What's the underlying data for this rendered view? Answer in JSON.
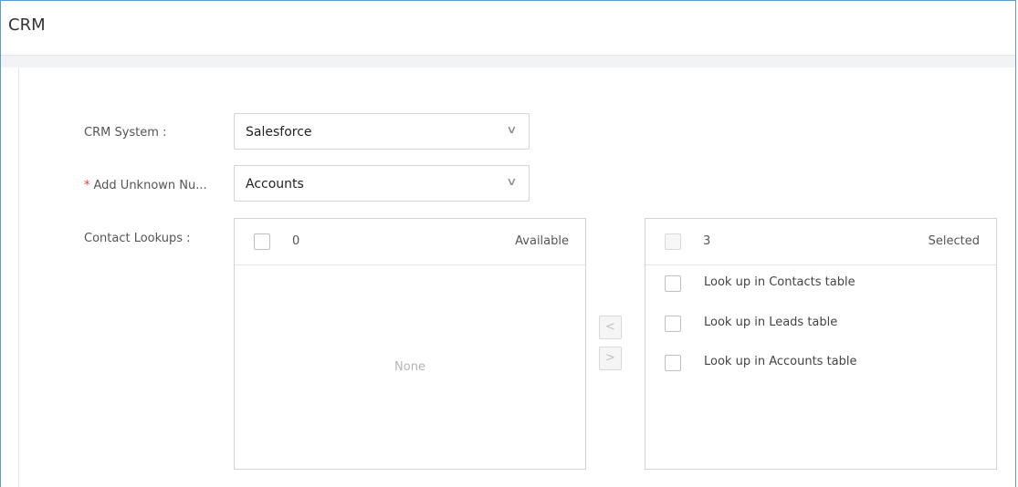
{
  "header": {
    "title": "CRM"
  },
  "form": {
    "crm_system": {
      "label": "CRM System :",
      "value": "Salesforce"
    },
    "add_unknown": {
      "required_mark": "*",
      "label": "Add Unknown Nu...",
      "value": "Accounts"
    },
    "contact_lookups": {
      "label": "Contact Lookups :"
    }
  },
  "transfer": {
    "available": {
      "count": "0",
      "title": "Available",
      "empty_text": "None"
    },
    "selected": {
      "count": "3",
      "title": "Selected",
      "items": [
        {
          "label": "Look up in Contacts table",
          "checked": false
        },
        {
          "label": "Look up in Leads table",
          "checked": false
        },
        {
          "label": "Look up in Accounts table",
          "checked": false
        }
      ]
    },
    "buttons": {
      "move_left": "<",
      "move_right": ">"
    }
  },
  "icons": {
    "select_chevron": "chevron-down-icon"
  },
  "colors": {
    "frame_border": "#5b9bd5",
    "required": "#e53935",
    "band": "#f2f3f5"
  }
}
